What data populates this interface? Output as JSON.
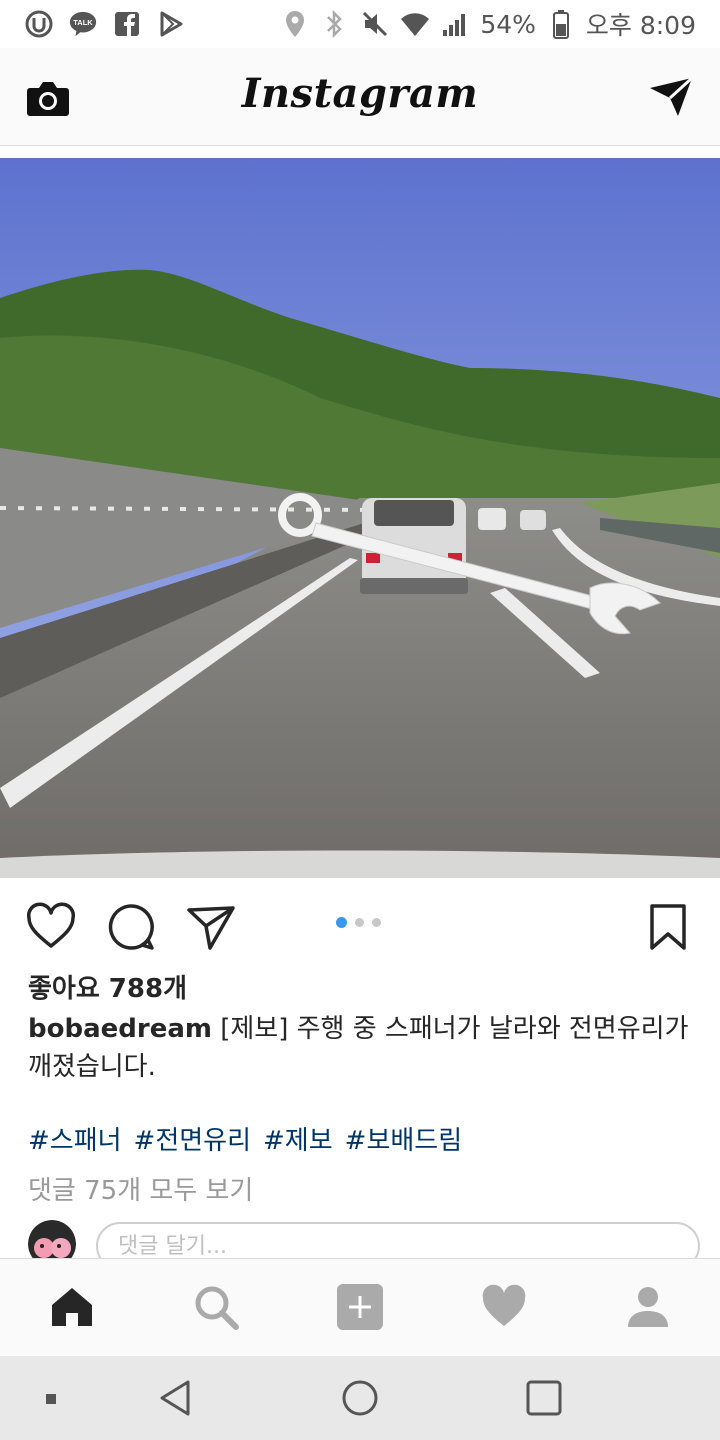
{
  "status_bar": {
    "battery": "54%",
    "time": "오후 8:09",
    "left_icons": [
      "u-plus-icon",
      "kakaotalk-icon",
      "facebook-icon",
      "play-store-icon"
    ],
    "right_icons": [
      "location-icon",
      "bluetooth-icon",
      "mute-icon",
      "wifi-icon",
      "signal-icon",
      "battery-icon"
    ]
  },
  "header": {
    "title": "Instagram",
    "camera_icon": "camera-icon",
    "direct_icon": "direct-message-icon"
  },
  "post": {
    "image_description_icon": "dashcam-photo",
    "carousel": {
      "count": 3,
      "active_index": 0,
      "active_color": "#3897f0",
      "inactive_color": "#c7c7c7"
    },
    "likes": "좋아요 788개",
    "username": "bobaedream",
    "caption": " [제보] 주행 중 스패너가 날라와 전면유리가 깨졌습니다.",
    "hashtags": [
      "#스패너",
      "#전면유리",
      "#제보",
      "#보배드림"
    ],
    "view_comments": "댓글 75개 모두 보기",
    "comment_placeholder": "댓글 달기..."
  },
  "tabbar": {
    "items": [
      "home-icon",
      "search-icon",
      "add-post-icon",
      "activity-heart-icon",
      "profile-icon"
    ]
  },
  "colors": {
    "hashtag": "#003569",
    "muted": "#999999",
    "text": "#262626"
  }
}
